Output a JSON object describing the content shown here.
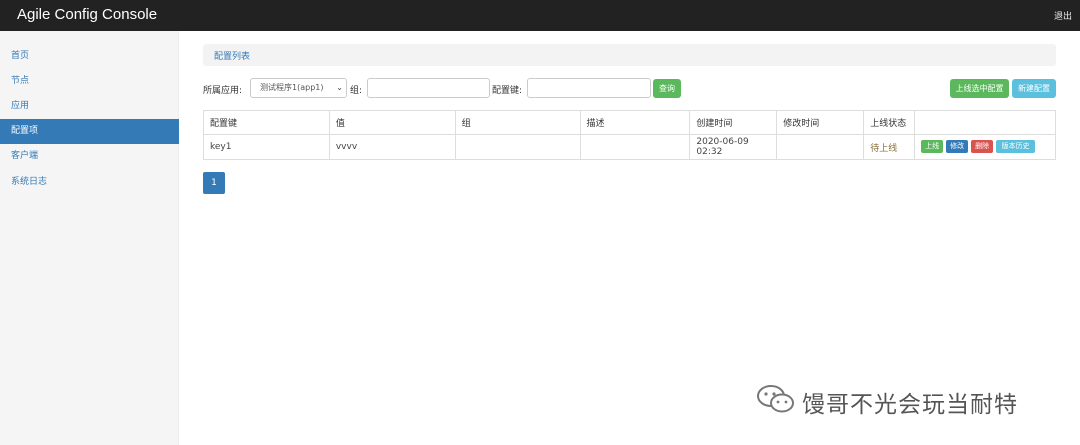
{
  "header": {
    "title": "Agile Config Console",
    "logout": "退出"
  },
  "sidebar": {
    "items": [
      {
        "label": "首页",
        "active": false
      },
      {
        "label": "节点",
        "active": false
      },
      {
        "label": "应用",
        "active": false
      },
      {
        "label": "配置项",
        "active": true
      },
      {
        "label": "客户端",
        "active": false
      },
      {
        "label": "系统日志",
        "active": false
      }
    ]
  },
  "breadcrumb": "配置列表",
  "filters": {
    "app_label": "所属应用:",
    "app_value": "测试程序1(app1)",
    "group_label": "组:",
    "group_value": "",
    "key_label": "配置键:",
    "key_value": "",
    "query_button": "查询"
  },
  "actions": {
    "publish_selected": "上线选中配置",
    "new_config": "新建配置"
  },
  "table": {
    "columns": [
      "配置键",
      "值",
      "组",
      "描述",
      "创建时间",
      "修改时间",
      "上线状态",
      ""
    ],
    "rows": [
      {
        "key": "key1",
        "value": "vvvv",
        "group": "",
        "desc": "",
        "created": "2020-06-09 02:32",
        "modified": "",
        "status": "待上线",
        "buttons": {
          "publish": "上线",
          "edit": "修改",
          "delete": "删除",
          "history": "版本历史"
        }
      }
    ]
  },
  "pagination": {
    "current": "1"
  },
  "watermark": "馒哥不光会玩当耐特",
  "colors": {
    "primary": "#337ab7",
    "success": "#5cb85c",
    "info": "#5bc0de",
    "danger": "#d9534f",
    "navbar": "#222222"
  }
}
